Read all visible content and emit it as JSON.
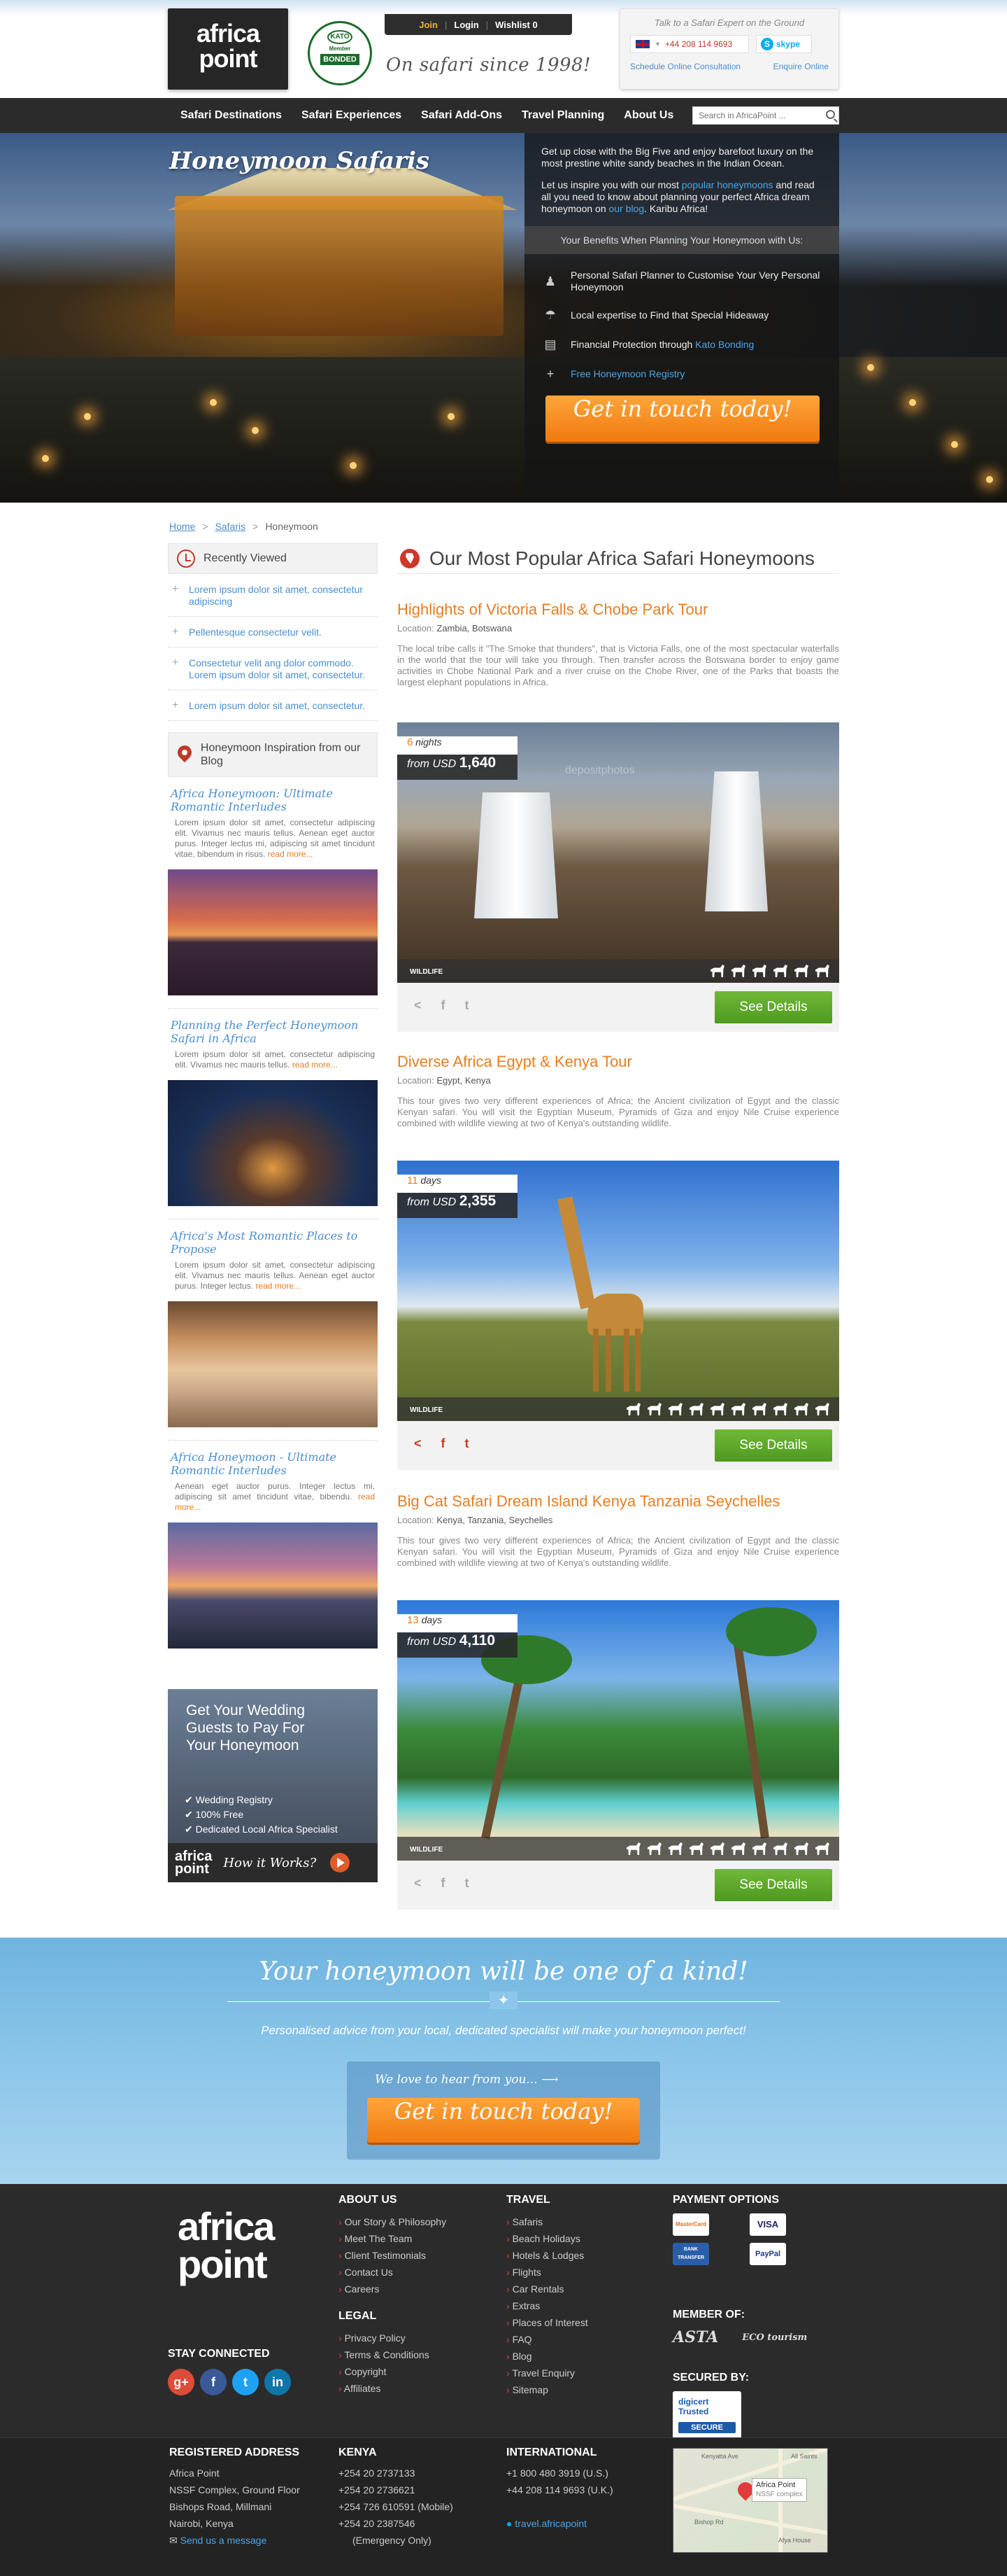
{
  "header": {
    "logo": {
      "line1": "africa",
      "line2": "point"
    },
    "kato": {
      "top": "KATO",
      "middle": "Member",
      "bottom": "BONDED"
    },
    "user_menu": {
      "join": "Join",
      "login": "Login",
      "wishlist": "Wishlist 0"
    },
    "tagline": "On safari since 1998!",
    "expert": {
      "title": "Talk to a Safari Expert on the Ground",
      "phone": "+44 208 114 9693",
      "skype": "skype",
      "schedule_link": "Schedule Online Consultation",
      "enquire_link": "Enquire Online"
    }
  },
  "nav": {
    "items": [
      "Safari Destinations",
      "Safari Experiences",
      "Safari Add-Ons",
      "Travel Planning",
      "About Us"
    ],
    "search_placeholder": "Search in AfricaPoint ..."
  },
  "hero": {
    "title": "Honeymoon Safaris",
    "intro": "Get up close with the Big Five and enjoy barefoot luxury on the most prestine white sandy beaches in the Indian Ocean.",
    "inspire_pre": "Let us inspire you with our most ",
    "inspire_link": "popular honeymoons",
    "inspire_mid": " and read all you need to know about planning your perfect Africa dream honeymoon on ",
    "inspire_blog": "our blog",
    "inspire_post": ". Karibu Africa!",
    "benefits_title": "Your Benefits When Planning Your Honeymoon with Us:",
    "benefits": [
      {
        "text": "Personal Safari Planner to Customise Your Very Personal Honeymoon",
        "icon": "user-icon",
        "link": ""
      },
      {
        "text": "Local expertise to Find that Special Hideaway",
        "icon": "umbrella-icon",
        "link": ""
      },
      {
        "text": "Financial Protection through ",
        "icon": "money-icon",
        "link": "Kato Bonding"
      },
      {
        "text": "",
        "icon": "plus-icon",
        "link": "Free Honeymoon Registry"
      }
    ],
    "cta": "Get in touch today!"
  },
  "breadcrumb": {
    "home": "Home",
    "safaris": "Safaris",
    "current": "Honeymoon"
  },
  "sidebar": {
    "recently_viewed_title": "Recently Viewed",
    "recently_viewed": [
      "Lorem ipsum dolor sit amet, consectetur adipiscing",
      "Pellentesque consectetur velit.",
      "Consectetur velit ang dolor commodo. Lorem ipsum dolor sit amet, consectetur.",
      "Lorem ipsum dolor sit amet, consectetur."
    ],
    "blog_title": "Honeymoon Inspiration from our Blog",
    "posts": [
      {
        "title": "Africa Honeymoon: Ultimate Romantic Interludes",
        "text": "Lorem ipsum dolor sit amet, consectetur adipiscing elit. Vivamus nec mauris tellus. Aenean eget auctor purus. Integer lectus mi, adipiscing sit amet tincidunt vitae, bibendum in risus.",
        "more": "read more..."
      },
      {
        "title": "Planning the Perfect Honeymoon Safari in Africa",
        "text": "Lorem ipsum dolor sit amet, consectetur adipiscing elit. Vivamus nec mauris tellus.",
        "more": "read more..."
      },
      {
        "title": "Africa's Most Romantic Places to Propose",
        "text": "Lorem ipsum dolor sit amet, consectetur adipiscing elit. Vivamus nec mauris tellus. Aenean eget auctor purus. Integer lectus.",
        "more": "read more..."
      },
      {
        "title": "Africa Honeymoon - Ultimate Romantic Interludes",
        "text": "Aenean eget auctor purus. Integer lectus mi, adipiscing sit amet tincidunt vitae, bibendu.",
        "more": "read more..."
      }
    ],
    "wedding": {
      "title": "Get Your Wedding Guests to Pay For Your Honeymoon",
      "items": [
        "Wedding Registry",
        "100% Free",
        "Dedicated Local Africa Specialist"
      ],
      "logo1": "africa",
      "logo2": "point",
      "how": "How it Works?"
    }
  },
  "main": {
    "heading": "Our Most Popular Africa Safari Honeymoons",
    "location_label": "Location:",
    "from_label": "from USD",
    "see_details": "See Details",
    "wildlife_label": "WILDLIFE",
    "tours": [
      {
        "title": "Highlights of Victoria Falls & Chobe Park Tour",
        "location": "Zambia, Botswana",
        "desc": "The local tribe calls it \"The Smoke that thunders\", that is Victoria Falls, one of the most spectacular waterfalls in the world that the tour will take you through. Then transfer across the Botswana border to enjoy game activities in Chobe National Park and a river cruise on the Chobe River, one of the Parks that boasts the largest elephant populations in Africa.",
        "duration_num": "6",
        "duration_unit": "nights",
        "price": "1,640",
        "watermark": "depositphotos"
      },
      {
        "title": "Diverse Africa Egypt & Kenya Tour",
        "location": "Egypt, Kenya",
        "desc": "This tour gives two very different experiences of Africa; the Ancient civilization of Egypt and the classic Kenyan safari. You will visit the Egyptian Museum, Pyramids of Giza and enjoy Nile Cruise experience combined with wildlife viewing at two of Kenya's outstanding wildlife.",
        "duration_num": "11",
        "duration_unit": "days",
        "price": "2,355",
        "watermark": ""
      },
      {
        "title": "Big Cat Safari Dream Island Kenya Tanzania Seychelles",
        "location": "Kenya, Tanzania, Seychelles",
        "desc": "This tour gives two very different experiences of Africa; the Ancient civilization of Egypt and the classic Kenyan safari. You will visit the Egyptian Museum, Pyramids of Giza and enjoy Nile Cruise experience combined with wildlife viewing at two of Kenya's outstanding wildlife.",
        "duration_num": "13",
        "duration_unit": "days",
        "price": "4,110",
        "watermark": ""
      }
    ]
  },
  "band": {
    "title": "Your honeymoon will be one of a kind!",
    "subtitle": "Personalised advice from your local, dedicated specialist will  make your honeymoon perfect!",
    "love": "We love to hear from you...",
    "cta": "Get in touch today!"
  },
  "footer": {
    "logo1": "africa",
    "logo2": "point",
    "about_title": "ABOUT US",
    "about": [
      "Our Story & Philosophy",
      "Meet The Team",
      "Client Testimonials",
      "Contact Us",
      "Careers"
    ],
    "legal_title": "LEGAL",
    "legal": [
      "Privacy Policy",
      "Terms & Conditions",
      "Copyright",
      "Affiliates"
    ],
    "travel_title": "TRAVEL",
    "travel": [
      "Safaris",
      "Beach Holidays",
      "Hotels & Lodges",
      "Flights",
      "Car Rentals",
      "Extras",
      "Places of Interest",
      "FAQ",
      "Blog",
      "Travel Enquiry",
      "Sitemap"
    ],
    "payment_title": "PAYMENT OPTIONS",
    "payments": [
      "MasterCard",
      "VISA",
      "BANK TRANSFER",
      "PayPal"
    ],
    "member_title": "MEMBER OF:",
    "members": [
      "ASTA",
      "ECO tourism"
    ],
    "secured_title": "SECURED BY:",
    "digicert": {
      "name": "digicert",
      "trusted": "Trusted",
      "secure": "SECURE"
    },
    "stay_title": "STAY CONNECTED",
    "social": [
      "g+",
      "f",
      "t",
      "in"
    ],
    "registered_title": "REGISTERED ADDRESS",
    "address": [
      "Africa Point",
      "NSSF Complex, Ground Floor",
      "Bishops Road, Millmani",
      "Nairobi, Kenya"
    ],
    "send_message": "Send us a message",
    "kenya_title": "KENYA",
    "kenya_phones": [
      "+254 20 2737133",
      "+254 20 2736621",
      "+254 726 610591 (Mobile)",
      "+254 20 2387546",
      "(Emergency Only)"
    ],
    "intl_title": "INTERNATIONAL",
    "intl_phones": [
      "+1 800 480 3919 (U.S.)",
      "+44 208 114 9693 (U.K.)"
    ],
    "skype": "travel.africapoint",
    "map": {
      "label": "Africa Point",
      "sub": "NSSF complex",
      "road1": "Kenyatta Ave",
      "road2": "Bishop Rd",
      "hospital": "All Saints",
      "afya": "Afya House"
    }
  }
}
